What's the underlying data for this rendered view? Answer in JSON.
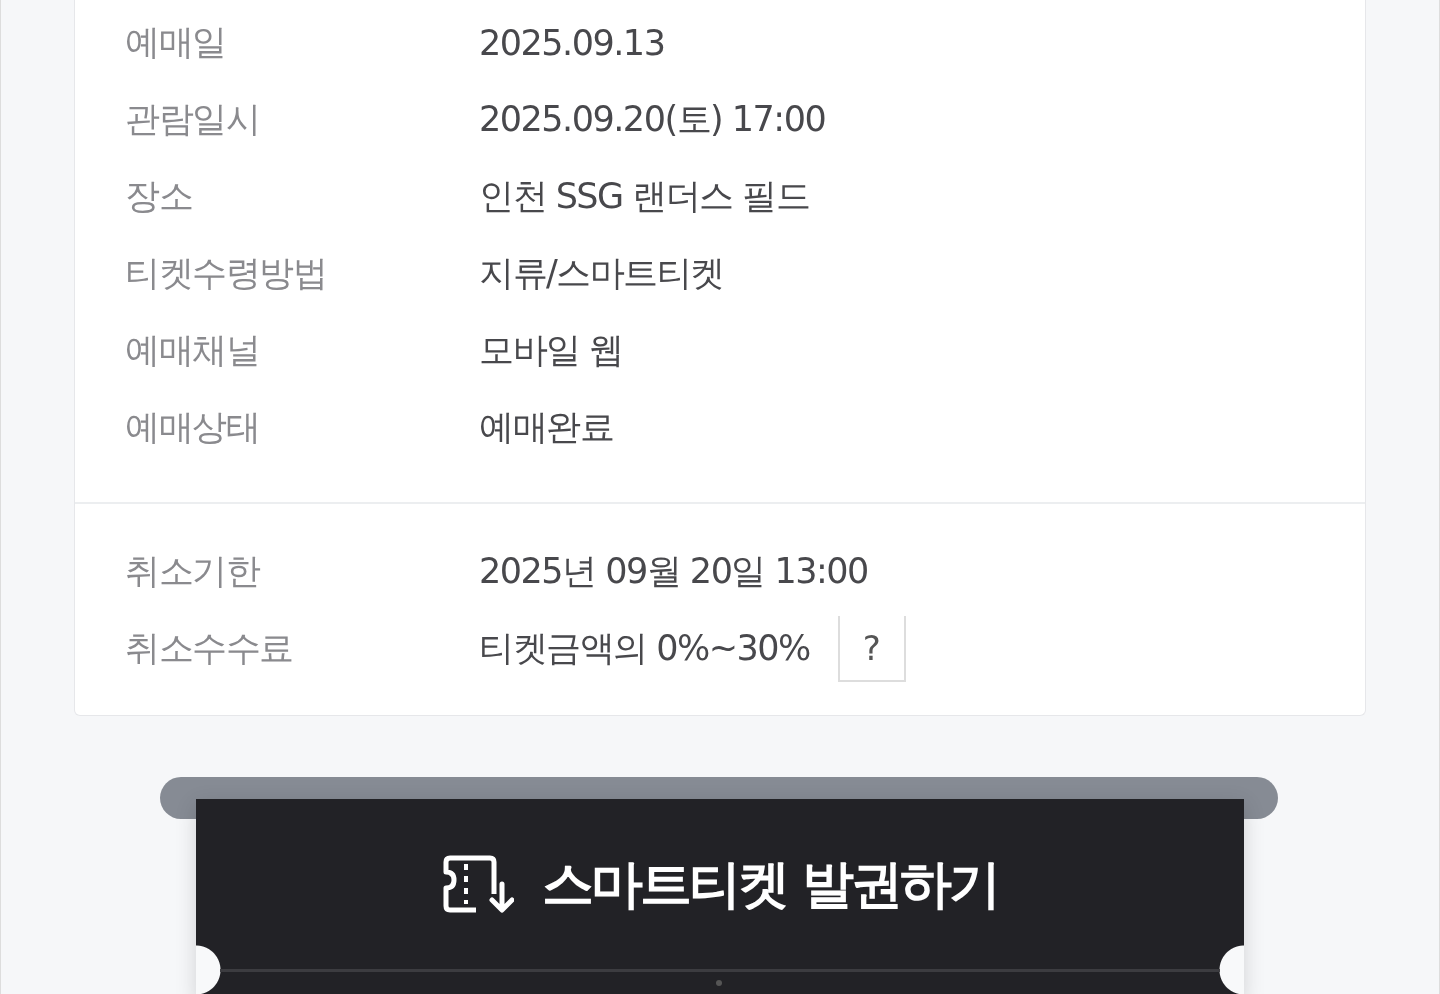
{
  "details": [
    {
      "label": "예매일",
      "value": "2025.09.13"
    },
    {
      "label": "관람일시",
      "value": "2025.09.20(토) 17:00"
    },
    {
      "label": "장소",
      "value": "인천 SSG 랜더스 필드"
    },
    {
      "label": "티켓수령방법",
      "value": "지류/스마트티켓"
    },
    {
      "label": "예매채널",
      "value": "모바일 웹"
    },
    {
      "label": "예매상태",
      "value": "예매완료"
    }
  ],
  "cancellation": [
    {
      "label": "취소기한",
      "value": "2025년 09월 20일 13:00"
    },
    {
      "label": "취소수수료",
      "value": "티켓금액의 0%~30%",
      "help": "?"
    }
  ],
  "issue_button": {
    "label": "스마트티켓 발권하기"
  }
}
